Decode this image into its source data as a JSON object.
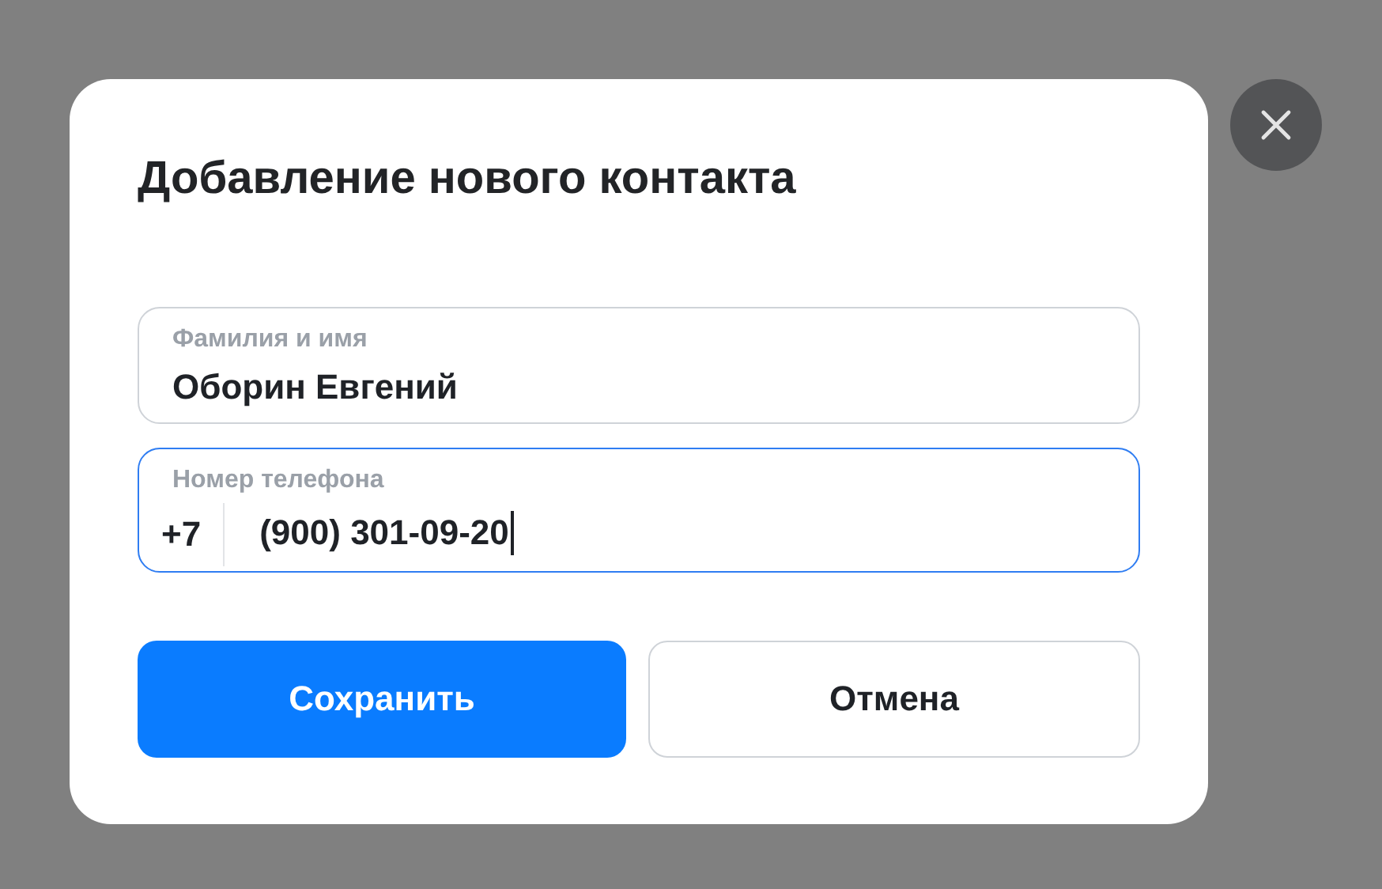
{
  "dialog": {
    "title": "Добавление нового контакта"
  },
  "fields": [
    {
      "kind": "text",
      "label": "Фамилия и имя",
      "value": "Оборин Евгений",
      "focused": false
    },
    {
      "kind": "phone",
      "label": "Номер телефона",
      "prefix": "+7",
      "value": "(900) 301-09-20",
      "focused": true
    }
  ],
  "buttons": [
    {
      "label": "Сохранить",
      "primary": true
    },
    {
      "label": "Отмена",
      "primary": false
    }
  ]
}
